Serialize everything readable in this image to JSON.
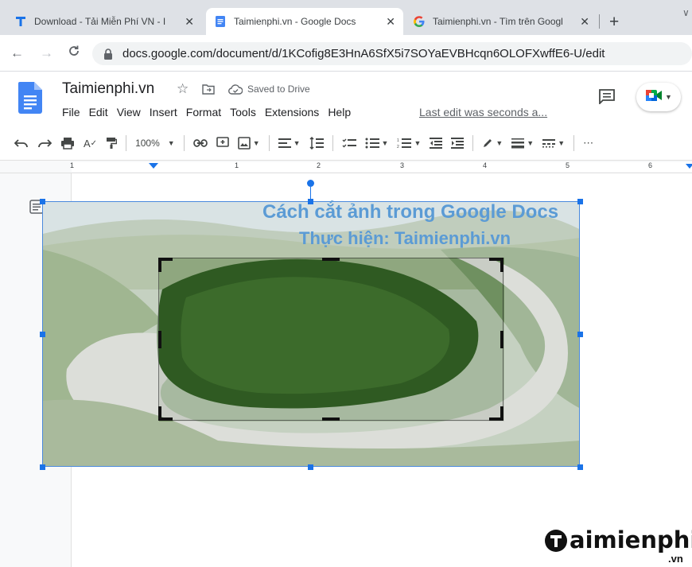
{
  "browser": {
    "tabs": [
      {
        "title": "Download - Tải Miễn Phí VN - I",
        "icon": "taimienphi-t-icon",
        "active": false
      },
      {
        "title": "Taimienphi.vn - Google Docs",
        "icon": "google-docs-icon",
        "active": true
      },
      {
        "title": "Taimienphi.vn - Tìm trên Googl",
        "icon": "google-g-icon",
        "active": false
      }
    ],
    "new_tab_label": "+",
    "close_glyph": "✕",
    "url": "docs.google.com/document/d/1KCofig8E3HnA6SfX5i7SOYaEVBHcqn6OLOFXwffE6-U/edit"
  },
  "docs": {
    "title": "Taimienphi.vn",
    "saved_status": "Saved to Drive",
    "menu": [
      "File",
      "Edit",
      "View",
      "Insert",
      "Format",
      "Tools",
      "Extensions",
      "Help"
    ],
    "last_edit": "Last edit was seconds a...",
    "zoom": "100%",
    "more_label": "⋯",
    "ruler_numbers": [
      "1",
      "1",
      "2",
      "3",
      "4",
      "5",
      "6"
    ]
  },
  "image": {
    "caption_line1": "Cách cắt ảnh trong Google Docs",
    "caption_line2": "Thực hiện: Taimienphi.vn"
  },
  "watermark": {
    "text": "aimienphi",
    "suffix": ".vn"
  },
  "colors": {
    "selection_blue": "#1a73e8",
    "caption_blue": "#5b9bd5",
    "docs_blue": "#4285f4"
  }
}
